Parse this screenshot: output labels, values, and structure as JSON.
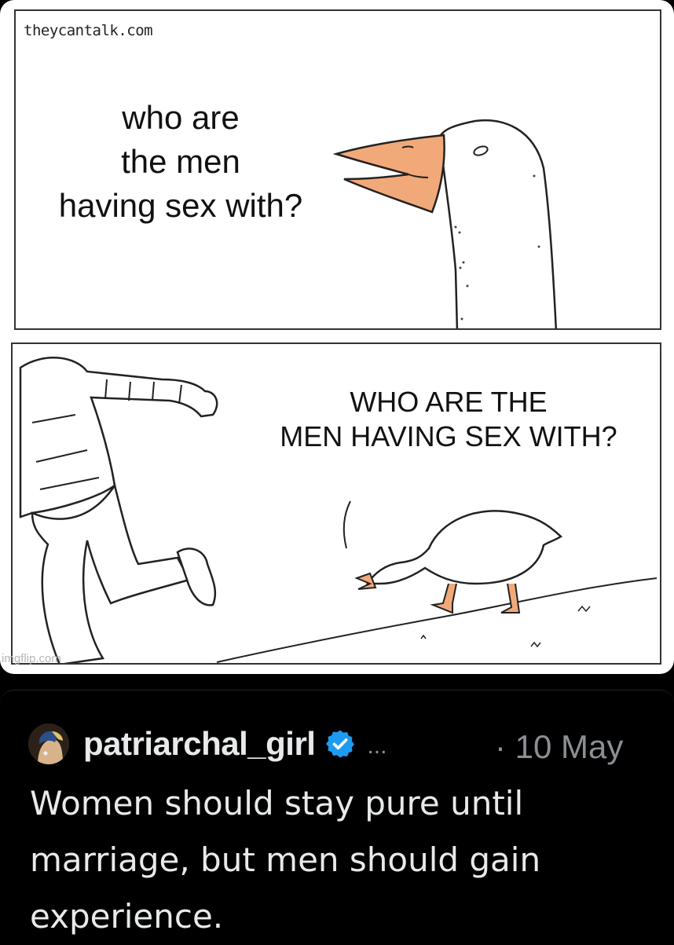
{
  "meme": {
    "watermark_top": "theycantalk.com",
    "panel1_caption": "who are\nthe men\nhaving sex with?",
    "panel2_caption": "WHO ARE THE\nMEN HAVING SEX WITH?",
    "watermark_bottom": "imgflip.com"
  },
  "tweet": {
    "username": "patriarchal_girl",
    "more": "...",
    "date": "· 10 May",
    "text": "Women should stay pure until marriage, but men should gain experience."
  },
  "colors": {
    "background": "#000000",
    "text_primary": "#e7e9ea",
    "text_secondary": "#8b8f94",
    "verified_blue": "#1d9bf0",
    "beak_orange": "#f2a97a"
  },
  "icons": {
    "verified": "verified-badge-icon",
    "avatar": "avatar-pearl-earring"
  }
}
